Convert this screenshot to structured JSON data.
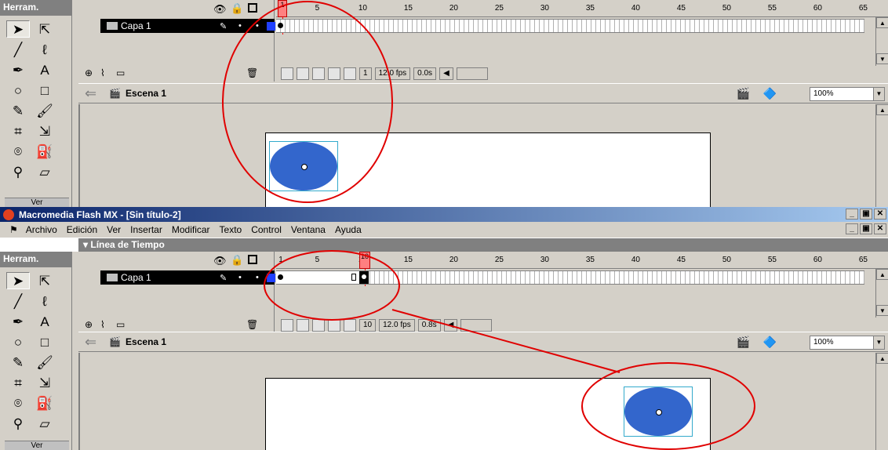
{
  "window": {
    "title": "Macromedia Flash MX - [Sin título-2]",
    "minimize": "_",
    "maximize": "▣",
    "close": "✕"
  },
  "menu": [
    "Archivo",
    "Edición",
    "Ver",
    "Insertar",
    "Modificar",
    "Texto",
    "Control",
    "Ventana",
    "Ayuda"
  ],
  "timeline_panel_title": "▾ Línea de Tiempo",
  "toolbox": {
    "title": "Herram.",
    "footer": "Ver"
  },
  "layer": {
    "name": "Capa 1"
  },
  "ruler": [
    "1",
    "5",
    "10",
    "15",
    "20",
    "25",
    "30",
    "35",
    "40",
    "45",
    "50",
    "55",
    "60",
    "65"
  ],
  "top_panel": {
    "current_frame": "1",
    "fps": "12.0 fps",
    "elapsed": "0.0s"
  },
  "bottom_panel": {
    "current_frame": "10",
    "fps": "12.0 fps",
    "elapsed": "0.8s"
  },
  "scene": {
    "name": "Escena 1",
    "zoom": "100%"
  },
  "colors": {
    "circle": "#3366cc",
    "annotation": "#e00000",
    "titlebar": "#0a246a"
  },
  "icons": [
    "arrow-tool-icon",
    "subselect-tool-icon",
    "line-tool-icon",
    "lasso-tool-icon",
    "pen-tool-icon",
    "text-tool-icon",
    "oval-tool-icon",
    "rectangle-tool-icon",
    "pencil-tool-icon",
    "brush-tool-icon",
    "free-transform-icon",
    "fill-transform-icon",
    "ink-bottle-icon",
    "paint-bucket-icon",
    "eyedropper-icon",
    "eraser-icon"
  ]
}
